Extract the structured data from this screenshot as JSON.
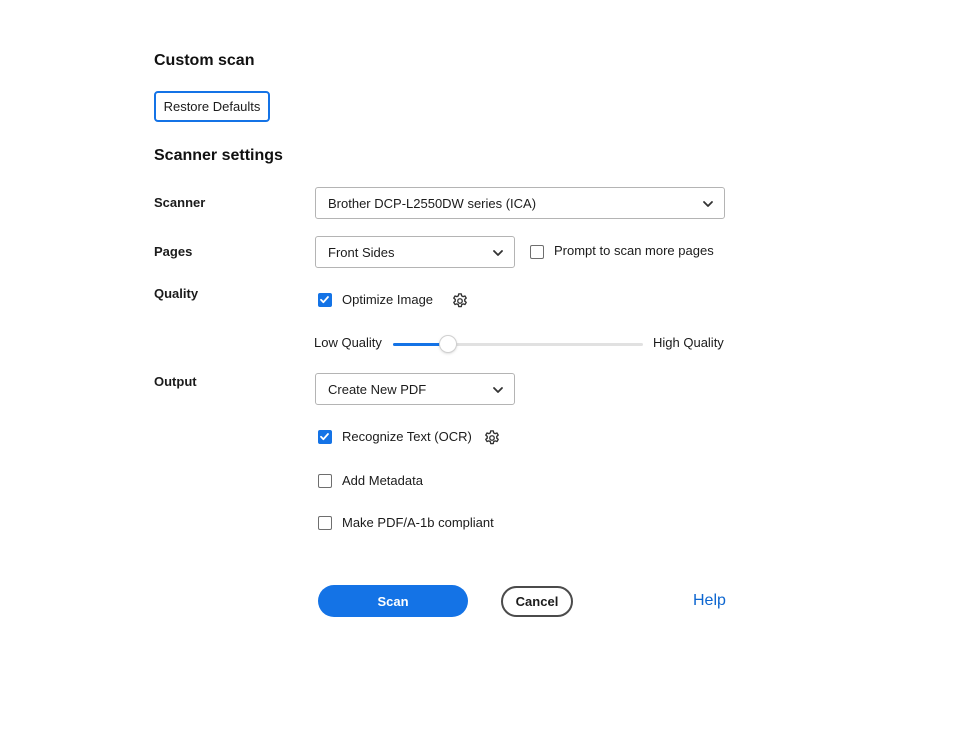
{
  "header": {
    "title": "Custom scan",
    "restore_defaults_label": "Restore Defaults",
    "section_title": "Scanner settings"
  },
  "scanner": {
    "label": "Scanner",
    "selected": "Brother DCP-L2550DW series (ICA)"
  },
  "pages": {
    "label": "Pages",
    "selected": "Front Sides",
    "prompt_more_pages": {
      "label": "Prompt to scan more pages",
      "checked": false
    }
  },
  "quality": {
    "label": "Quality",
    "optimize_image": {
      "label": "Optimize Image",
      "checked": true
    },
    "slider": {
      "low_label": "Low Quality",
      "high_label": "High Quality",
      "value_fraction": 0.22
    }
  },
  "output": {
    "label": "Output",
    "selected": "Create New PDF",
    "recognize_text": {
      "label": "Recognize Text (OCR)",
      "checked": true
    },
    "add_metadata": {
      "label": "Add Metadata",
      "checked": false
    },
    "pdfa_compliant": {
      "label": "Make PDF/A-1b compliant",
      "checked": false
    }
  },
  "footer": {
    "scan_label": "Scan",
    "cancel_label": "Cancel",
    "help_label": "Help"
  },
  "colors": {
    "accent": "#1473e6",
    "link": "#0d66d0"
  },
  "icons": {
    "chevron": "chevron-down-icon",
    "gear": "gear-icon",
    "check": "checkmark-icon"
  }
}
